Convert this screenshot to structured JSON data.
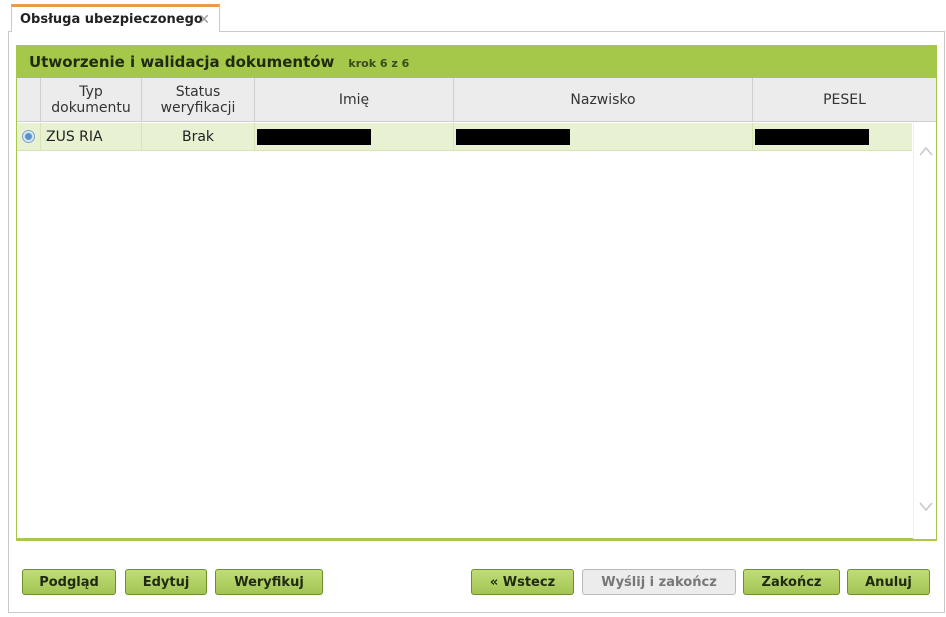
{
  "tab": {
    "label": "Obsługa ubezpieczonego",
    "close_glyph": "✕"
  },
  "panel": {
    "title": "Utworzenie i walidacja dokumentów",
    "step": "krok 6 z 6"
  },
  "table": {
    "columns": [
      "Typ\ndokumentu",
      "Status\nweryfikacji",
      "Imię",
      "Nazwisko",
      "PESEL"
    ],
    "rows": [
      {
        "type": "ZUS RIA",
        "status": "Brak",
        "imie": "",
        "nazwisko": "",
        "pesel": ""
      }
    ]
  },
  "buttons": {
    "preview": "Podgląd",
    "edit": "Edytuj",
    "verify": "Weryfikuj",
    "back": "« Wstecz",
    "send_finish": "Wyślij i zakończ",
    "finish": "Zakończ",
    "cancel": "Anuluj"
  },
  "icons": {
    "scroll_up": "chevron-up-icon",
    "scroll_down": "chevron-down-icon",
    "close": "close-icon"
  },
  "colors": {
    "accent_green": "#a5c84a",
    "tab_accent": "#e89a4a",
    "row_highlight": "#e8f2d3"
  }
}
